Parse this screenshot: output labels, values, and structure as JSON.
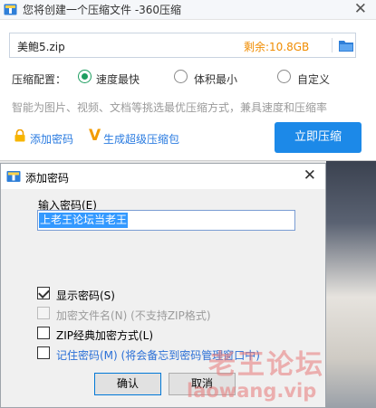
{
  "window": {
    "title": "您将创建一个压缩文件 -360压缩",
    "close_glyph": "✕",
    "path": {
      "filename": "美鲍5.zip",
      "free_space": "剩余:10.8GB",
      "dropdown_glyph": "▼"
    },
    "config_label": "压缩配置：",
    "options": [
      {
        "label": "速度最快",
        "selected": true
      },
      {
        "label": "体积最小",
        "selected": false
      },
      {
        "label": "自定义",
        "selected": false
      }
    ],
    "hint": "智能为图片、视频、文档等挑选最优压缩方式，兼具速度和压缩率",
    "add_password_link": "添加密码",
    "super_package_link": "生成超级压缩包",
    "compress_button": "立即压缩",
    "accent_color": "#1c89e8",
    "free_space_color": "#f08c00"
  },
  "dialog": {
    "title": "添加密码",
    "close_glyph": "✕",
    "input_label": "输入密码(E)",
    "password_value": "上老王论坛当老王",
    "checkboxes": [
      {
        "label": "显示密码(S)",
        "checked": true,
        "enabled": true
      },
      {
        "label": "加密文件名(N) (不支持ZIP格式)",
        "checked": false,
        "enabled": false
      },
      {
        "label": "ZIP经典加密方式(L)",
        "checked": false,
        "enabled": true
      },
      {
        "label": "记住密码(M) (将会备忘到密码管理窗口中)",
        "checked": false,
        "enabled": true
      }
    ],
    "ok_button": "确认",
    "cancel_button": "取消"
  },
  "watermark": {
    "line1": "老王论坛",
    "line2": "laowang.vip"
  }
}
